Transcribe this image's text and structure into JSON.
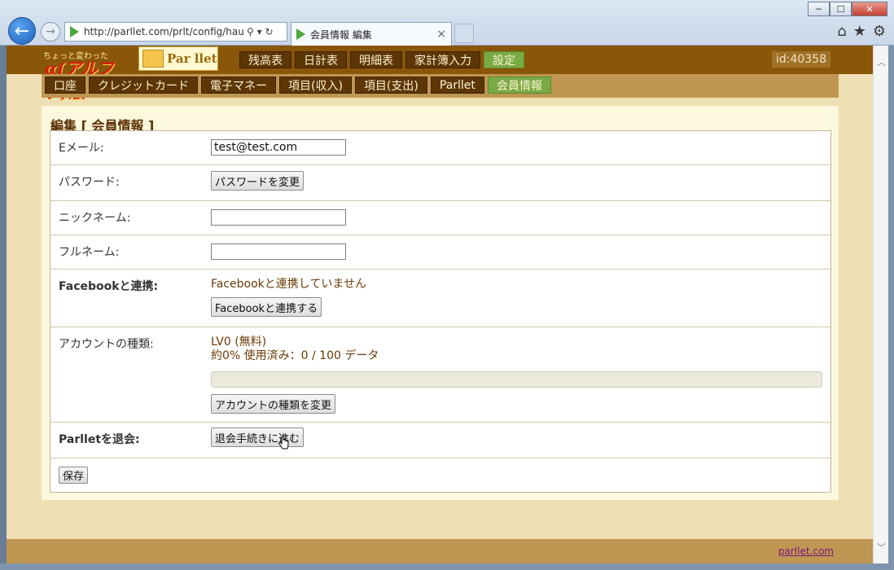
{
  "browser": {
    "url": "http://parllet.com/prlt/config/hau",
    "address_tools": "⚲ ▾ ↻",
    "tab_title": "会員情報 編集",
    "tab_close": "×",
    "win_minimize": "─",
    "win_maximize": "☐",
    "win_close": "✕",
    "back_glyph": "←",
    "forward_glyph": "→",
    "home_glyph": "⌂",
    "favorites_glyph": "★",
    "settings_glyph": "⚙"
  },
  "site": {
    "logo_small": "ちょっと変わった",
    "logo_big": "α(アルファ)版",
    "logo2_text": "Par llet",
    "user_id": "id:40358",
    "main_nav": [
      {
        "label": "残高表",
        "active": false
      },
      {
        "label": "日計表",
        "active": false
      },
      {
        "label": "明細表",
        "active": false
      },
      {
        "label": "家計簿入力",
        "active": false
      },
      {
        "label": "設定",
        "active": true
      }
    ],
    "sub_nav": [
      {
        "label": "口座",
        "active": false
      },
      {
        "label": "クレジットカード",
        "active": false
      },
      {
        "label": "電子マネー",
        "active": false
      },
      {
        "label": "項目(収入)",
        "active": false
      },
      {
        "label": "項目(支出)",
        "active": false
      },
      {
        "label": "Parllet",
        "active": false
      },
      {
        "label": "会員情報",
        "active": true
      }
    ],
    "accent_green": "#79ab45",
    "brand_brown": "#8a5608"
  },
  "form": {
    "heading": "編集 [ 会員情報 ]",
    "email_label": "Eメール:",
    "email_value": "test@test.com",
    "password_label": "パスワード:",
    "password_button": "パスワードを変更",
    "nickname_label": "ニックネーム:",
    "nickname_value": "",
    "fullname_label": "フルネーム:",
    "fullname_value": "",
    "facebook_label": "Facebookと連携:",
    "facebook_status": "Facebookと連携していません",
    "facebook_button": "Facebookと連携する",
    "account_label": "アカウントの種類:",
    "account_level": "LV0 (無料)",
    "account_usage": "約0% 使用済み：0 / 100 データ",
    "usage_fraction": 0,
    "account_button": "アカウントの種類を変更",
    "withdraw_label": "Parlletを退会:",
    "withdraw_button": "退会手続きに進む",
    "save_button": "保存"
  },
  "footer": {
    "link": "parllet.com"
  }
}
